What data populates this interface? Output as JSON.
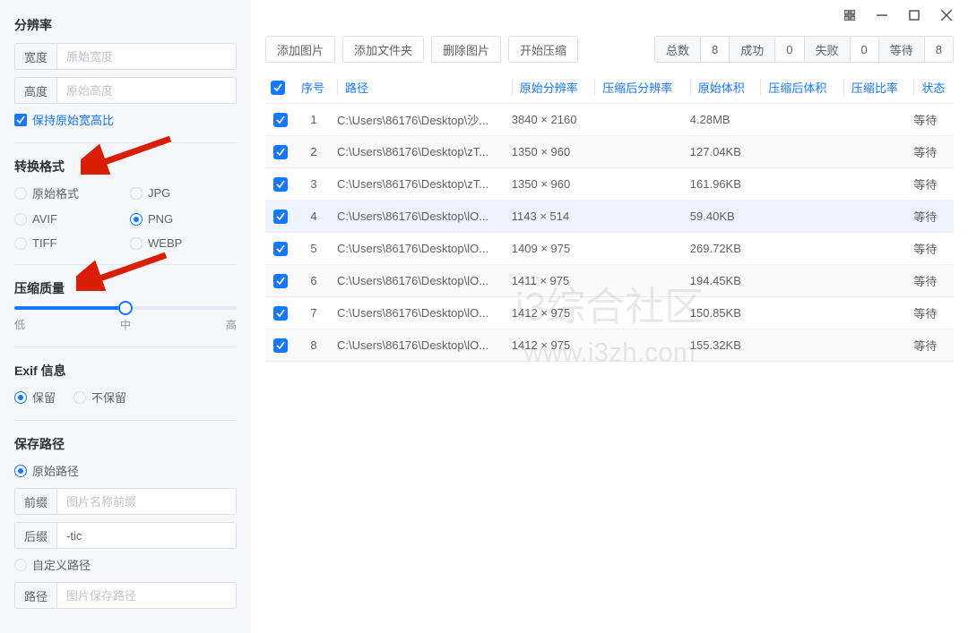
{
  "sidebar": {
    "resolution": {
      "title": "分辨率",
      "widthLabel": "宽度",
      "widthPh": "原始宽度",
      "heightLabel": "高度",
      "heightPh": "原始高度",
      "keepRatio": "保持原始宽高比"
    },
    "format": {
      "title": "转换格式",
      "options": [
        "原始格式",
        "JPG",
        "AVIF",
        "PNG",
        "TIFF",
        "WEBP"
      ],
      "selected": "PNG"
    },
    "quality": {
      "title": "压缩质量",
      "low": "低",
      "mid": "中",
      "high": "高"
    },
    "exif": {
      "title": "Exif 信息",
      "keep": "保留",
      "noKeep": "不保留",
      "selected": "保留"
    },
    "savePath": {
      "title": "保存路径",
      "original": "原始路径",
      "prefixLabel": "前缀",
      "prefixPh": "图片名称前缀",
      "suffixLabel": "后缀",
      "suffixVal": "-tic",
      "custom": "自定义路径",
      "pathLabel": "路径",
      "pathPh": "图片保存路径",
      "selected": "原始路径"
    }
  },
  "actions": {
    "addImage": "添加图片",
    "addFolder": "添加文件夹",
    "deleteImage": "删除图片",
    "startCompress": "开始压缩"
  },
  "stats": {
    "totalLabel": "总数",
    "total": "8",
    "successLabel": "成功",
    "success": "0",
    "failLabel": "失败",
    "fail": "0",
    "waitLabel": "等待",
    "wait": "8"
  },
  "columns": {
    "index": "序号",
    "path": "路径",
    "origRes": "原始分辨率",
    "compRes": "压缩后分辨率",
    "origSize": "原始体积",
    "compSize": "压缩后体积",
    "ratio": "压缩比率",
    "status": "状态"
  },
  "rows": [
    {
      "idx": "1",
      "path": "C:\\Users\\86176\\Desktop\\沙...",
      "origRes": "3840 × 2160",
      "origSize": "4.28MB",
      "status": "等待"
    },
    {
      "idx": "2",
      "path": "C:\\Users\\86176\\Desktop\\zT...",
      "origRes": "1350 × 960",
      "origSize": "127.04KB",
      "status": "等待"
    },
    {
      "idx": "3",
      "path": "C:\\Users\\86176\\Desktop\\zT...",
      "origRes": "1350 × 960",
      "origSize": "161.96KB",
      "status": "等待"
    },
    {
      "idx": "4",
      "path": "C:\\Users\\86176\\Desktop\\lO...",
      "origRes": "1143 × 514",
      "origSize": "59.40KB",
      "status": "等待",
      "highlight": true
    },
    {
      "idx": "5",
      "path": "C:\\Users\\86176\\Desktop\\lO...",
      "origRes": "1409 × 975",
      "origSize": "269.72KB",
      "status": "等待"
    },
    {
      "idx": "6",
      "path": "C:\\Users\\86176\\Desktop\\lO...",
      "origRes": "1411 × 975",
      "origSize": "194.45KB",
      "status": "等待"
    },
    {
      "idx": "7",
      "path": "C:\\Users\\86176\\Desktop\\lO...",
      "origRes": "1412 × 975",
      "origSize": "150.85KB",
      "status": "等待"
    },
    {
      "idx": "8",
      "path": "C:\\Users\\86176\\Desktop\\lO...",
      "origRes": "1412 × 975",
      "origSize": "155.32KB",
      "status": "等待"
    }
  ],
  "watermark": {
    "line1": "i3综合社区",
    "line2": "www.i3zh.com"
  }
}
